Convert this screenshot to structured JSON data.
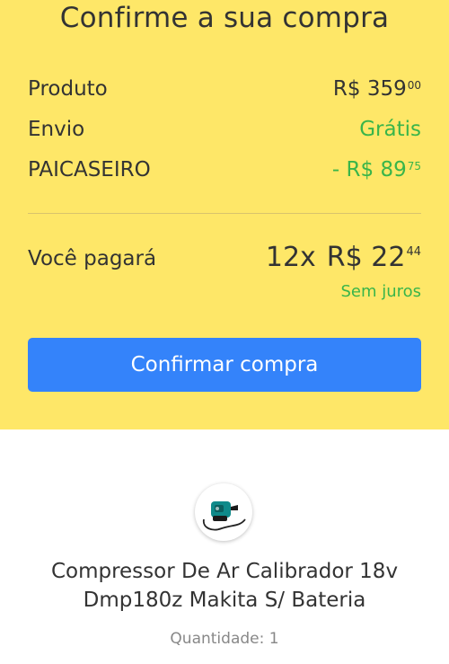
{
  "header": {
    "title": "Confirme a sua compra"
  },
  "summary": {
    "rows": [
      {
        "label": "Produto",
        "value_main": "R$ 359",
        "value_cents": "00"
      },
      {
        "label": "Envio",
        "value_main": "Grátis",
        "value_cents": ""
      },
      {
        "label": "PAICASEIRO",
        "value_main": "- R$ 89",
        "value_cents": "75"
      }
    ]
  },
  "payment": {
    "label": "Você pagará",
    "installments": "12x",
    "amount_main": "R$ 22",
    "amount_cents": "44",
    "interest_note": "Sem juros"
  },
  "actions": {
    "confirm_label": "Confirmar compra"
  },
  "product": {
    "image_icon": "air-compressor-image",
    "title": "Compressor De Ar Calibrador 18v Dmp180z Makita S/ Bateria",
    "quantity_text": "Quantidade: 1"
  },
  "colors": {
    "header_background": "#fee768",
    "primary_button": "#3483fa",
    "success_green": "#39b54a",
    "text_primary": "#333333",
    "text_secondary": "#888888"
  }
}
